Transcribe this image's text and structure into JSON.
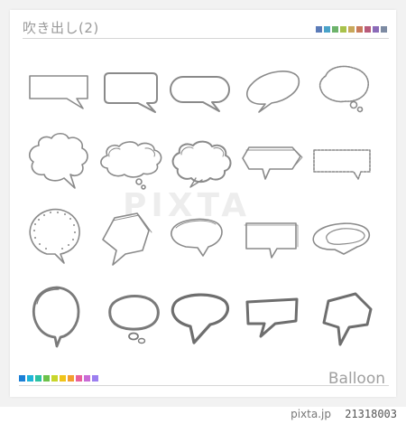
{
  "header": {
    "title": "吹き出し(2)"
  },
  "palette_top": [
    "#5b7bb8",
    "#4aa3c9",
    "#6db36b",
    "#a8c24b",
    "#c9a85b",
    "#c97b5b",
    "#b85b7b",
    "#8b6bb8",
    "#7d8ba3"
  ],
  "palette_bottom": [
    "#1b7fd6",
    "#1fb5d8",
    "#2bc2a3",
    "#6cc24a",
    "#c8d62b",
    "#f0c419",
    "#f29e30",
    "#e9609b",
    "#c96bd6",
    "#9c7ff0"
  ],
  "footer": {
    "label": "Balloon"
  },
  "watermark": {
    "text": "PIXTA"
  },
  "stock": {
    "brand": "pixta.jp",
    "id": "21318003"
  },
  "icons": [
    "rectangle-speech-bubble-icon",
    "rounded-speech-bubble-icon",
    "pill-speech-bubble-icon",
    "oval-speech-bubble-icon",
    "thought-bubble-icon",
    "cloud-bubble-icon",
    "cloud-thought-bubble-icon",
    "puffy-cloud-bubble-icon",
    "arrow-box-bubble-icon",
    "dashed-box-bubble-icon",
    "dotted-circle-bubble-icon",
    "hexagon-bubble-icon",
    "sketch-oval-bubble-icon",
    "sketch-box-bubble-icon",
    "sketch-ellipse-bubble-icon",
    "brush-circle-bubble-icon",
    "brush-thought-bubble-icon",
    "brush-oval-bubble-icon",
    "brush-box-bubble-icon",
    "brush-octagon-bubble-icon"
  ]
}
